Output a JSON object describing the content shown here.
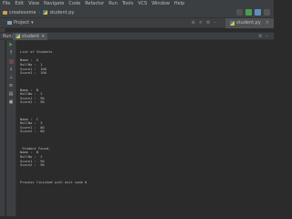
{
  "menu": [
    "File",
    "Edit",
    "View",
    "Navigate",
    "Code",
    "Refactor",
    "Run",
    "Tools",
    "VCS",
    "Window",
    "Help"
  ],
  "breadcrumb": {
    "project": "createsome",
    "file": "student.py"
  },
  "project_panel": {
    "label": "Project"
  },
  "editor_tab": {
    "label": "student.py"
  },
  "run_panel": {
    "label": "Run:",
    "tab": "student"
  },
  "console_lines": [
    "",
    "",
    "List of Students",
    "",
    "Name :  A",
    "RollNo :  1",
    "Score1 :  100",
    "Score2 :  100",
    "",
    "",
    "",
    "Name :  B",
    "RollNo :  2",
    "Score1 :  90",
    "Score2 :  90",
    "",
    "",
    "",
    "Name :  C",
    "RollNo :  3",
    "Score1 :  80",
    "Score2 :  80",
    "",
    "",
    "",
    " Student Found,",
    "Name :  B",
    "RollNo :  2",
    "Score1 :  90",
    "Score2 :  90",
    "",
    "",
    "",
    "Process finished with exit code 0"
  ],
  "colors": {
    "background": "#2b2b2b",
    "panel": "#3c3f41",
    "text": "#bbbbbb",
    "run_icon": "#499c54",
    "stop_icon": "#c75450"
  }
}
